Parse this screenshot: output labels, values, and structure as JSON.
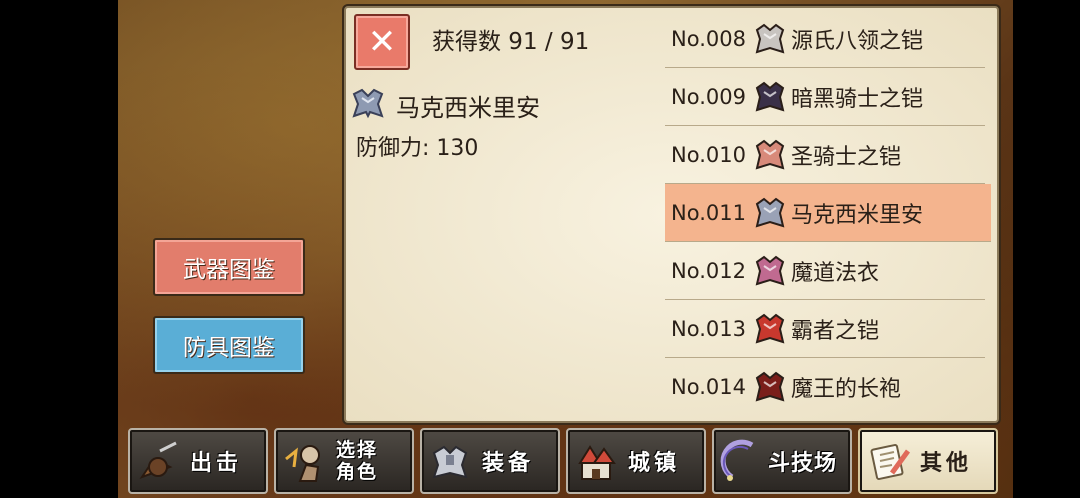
{
  "header": {
    "close_label": "✕",
    "count_label": "获得数  91 / 91"
  },
  "detail": {
    "icon": "armor-cloth-icon",
    "name": "马克西米里安",
    "defense": "防御力: 130"
  },
  "list": [
    {
      "num": "No.008",
      "name": "源氏八领之铠",
      "icon": "white-armor-icon",
      "color": "#c8c4c0",
      "selected": false
    },
    {
      "num": "No.009",
      "name": "暗黑骑士之铠",
      "icon": "dark-armor-icon",
      "color": "#3a3048",
      "selected": false
    },
    {
      "num": "No.010",
      "name": "圣骑士之铠",
      "icon": "holy-armor-icon",
      "color": "#d88a7a",
      "selected": false
    },
    {
      "num": "No.011",
      "name": "马克西米里安",
      "icon": "silver-armor-icon",
      "color": "#9aa2b6",
      "selected": true
    },
    {
      "num": "No.012",
      "name": "魔道法衣",
      "icon": "magic-robe-icon",
      "color": "#c06a90",
      "selected": false
    },
    {
      "num": "No.013",
      "name": "霸者之铠",
      "icon": "red-armor-icon",
      "color": "#c8382e",
      "selected": false
    },
    {
      "num": "No.014",
      "name": "魔王的长袍",
      "icon": "demon-robe-icon",
      "color": "#7a1e1a",
      "selected": false
    }
  ],
  "side_buttons": {
    "weapon": "武器图鉴",
    "armor": "防具图鉴"
  },
  "tabs": [
    {
      "label": "出击",
      "icon": "sortie-icon"
    },
    {
      "label": "选择角色",
      "line1": "选择",
      "line2": "角色",
      "icon": "character-icon"
    },
    {
      "label": "装备",
      "icon": "equipment-icon"
    },
    {
      "label": "城镇",
      "icon": "town-icon"
    },
    {
      "label": "斗技场",
      "icon": "arena-icon"
    },
    {
      "label": "其他",
      "icon": "other-icon",
      "active": true
    }
  ],
  "colors": {
    "selected_row": "#f4b48e",
    "weapon_button": "#e27d6c",
    "armor_button": "#5aaed6",
    "close_button": "#e97a6a"
  }
}
